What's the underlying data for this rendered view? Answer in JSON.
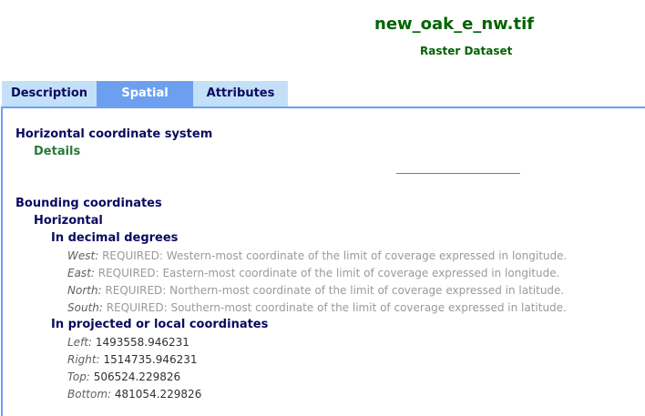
{
  "header": {
    "title": "new_oak_e_nw.tif",
    "subtitle": "Raster Dataset"
  },
  "tabs": [
    {
      "label": "Description"
    },
    {
      "label": "Spatial"
    },
    {
      "label": "Attributes"
    }
  ],
  "spatial": {
    "horizontal_cs_heading": "Horizontal coordinate system",
    "details_link": "Details",
    "bounding_heading": "Bounding coordinates",
    "horizontal_heading": "Horizontal",
    "decimal_heading": "In decimal degrees",
    "decimal": {
      "west_label": "West:",
      "west_value": "REQUIRED: Western-most coordinate of the limit of coverage expressed in longitude.",
      "east_label": "East:",
      "east_value": "REQUIRED: Eastern-most coordinate of the limit of coverage expressed in longitude.",
      "north_label": "North:",
      "north_value": "REQUIRED: Northern-most coordinate of the limit of coverage expressed in latitude.",
      "south_label": "South:",
      "south_value": "REQUIRED: Southern-most coordinate of the limit of coverage expressed in latitude."
    },
    "projected_heading": "In projected or local coordinates",
    "projected": {
      "left_label": "Left:",
      "left_value": "1493558.946231",
      "right_label": "Right:",
      "right_value": "1514735.946231",
      "top_label": "Top:",
      "top_value": "506524.229826",
      "bottom_label": "Bottom:",
      "bottom_value": "481054.229826"
    }
  },
  "colors": {
    "title_green": "#006400",
    "heading_navy": "#0a0a60",
    "active_tab": "#6d9ff0",
    "inactive_tab": "#c4e0f8"
  }
}
